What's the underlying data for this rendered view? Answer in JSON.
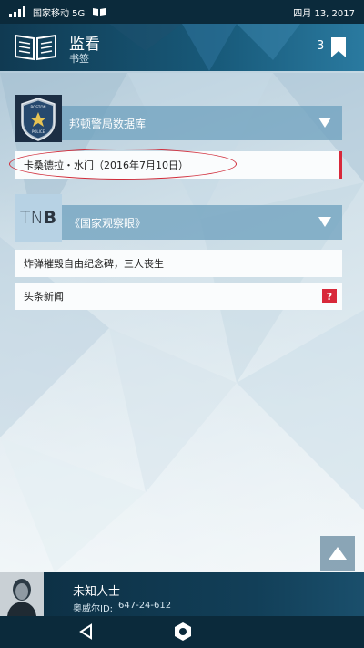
{
  "statusbar": {
    "carrier": "国家移动 5G",
    "date": "四月 13, 2017"
  },
  "header": {
    "title": "监看",
    "subtitle": "书签",
    "bookmark_count": "3"
  },
  "sections": [
    {
      "thumb_text": "BOSTON POLICE",
      "label": "邦顿警局数据库",
      "items": [
        {
          "text": "卡桑德拉・水门（2016年7月10日）"
        }
      ]
    },
    {
      "thumb_text": "TNB",
      "label": "《国家观察眼》",
      "items": [
        {
          "text": "炸弹摧毁自由纪念碑，三人丧生"
        },
        {
          "text": "头条新闻",
          "badge": "?"
        }
      ]
    }
  ],
  "profile": {
    "name": "未知人士",
    "id_label": "奥威尔ID:",
    "id_value": "647-24-612"
  },
  "colors": {
    "statusbar": "#0b2a3b",
    "header": "#185a7a",
    "section_header": "#6ea0be",
    "accent_red": "#d8283a"
  }
}
